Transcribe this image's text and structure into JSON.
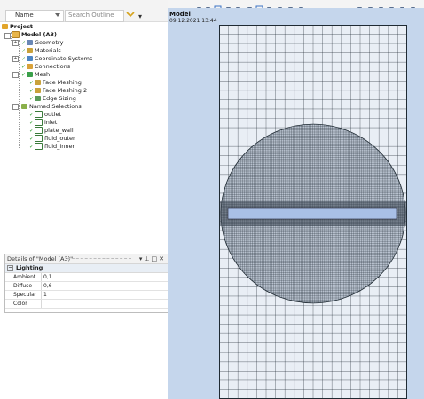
{
  "outline": {
    "name_dropdown": "Name",
    "search_placeholder": "Search Outline",
    "tree": {
      "project": "Project",
      "model": "Model (A3)",
      "items": [
        {
          "label": "Geometry",
          "icon": "geometry-icon",
          "level": 2,
          "expandable": true
        },
        {
          "label": "Materials",
          "icon": "materials-icon",
          "level": 2
        },
        {
          "label": "Coordinate Systems",
          "icon": "coordinate-systems-icon",
          "level": 2,
          "expandable": true
        },
        {
          "label": "Connections",
          "icon": "connections-icon",
          "level": 2
        },
        {
          "label": "Mesh",
          "icon": "mesh-icon",
          "level": 2,
          "expandable": true
        },
        {
          "label": "Face Meshing",
          "icon": "face-meshing-icon",
          "level": 3
        },
        {
          "label": "Face Meshing 2",
          "icon": "face-meshing-icon",
          "level": 3
        },
        {
          "label": "Edge Sizing",
          "icon": "edge-sizing-icon",
          "level": 3
        },
        {
          "label": "Named Selections",
          "icon": "named-selections-icon",
          "level": 2,
          "expandable": true
        },
        {
          "label": "outlet",
          "icon": "named-selection-icon",
          "level": 3
        },
        {
          "label": "inlet",
          "icon": "named-selection-icon",
          "level": 3
        },
        {
          "label": "plate_wall",
          "icon": "named-selection-icon",
          "level": 3
        },
        {
          "label": "fluid_outer",
          "icon": "named-selection-icon",
          "level": 3
        },
        {
          "label": "fluid_inner",
          "icon": "named-selection-icon",
          "level": 3
        }
      ]
    }
  },
  "details": {
    "title": "Details of \"Model (A3)\"",
    "section": "Lighting",
    "rows": [
      {
        "key": "Ambient",
        "value": "0,1"
      },
      {
        "key": "Diffuse",
        "value": "0,6"
      },
      {
        "key": "Specular",
        "value": "1"
      },
      {
        "key": "Color",
        "value": ""
      }
    ]
  },
  "viewport": {
    "title": "Model",
    "date": "09.12.2021 13:44"
  },
  "colors": {
    "mesh_line": "#1f2a33",
    "viewport_bg": "#c5d6ec",
    "plate": "#a9c0e6",
    "check": "#2d9e2d"
  }
}
